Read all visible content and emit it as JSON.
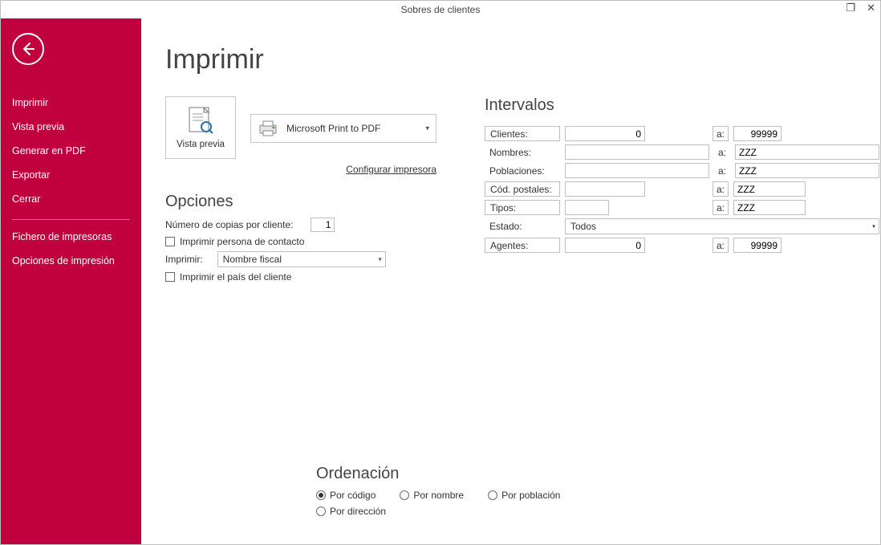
{
  "window": {
    "title": "Sobres de clientes"
  },
  "sidebar": {
    "items": [
      {
        "label": "Imprimir"
      },
      {
        "label": "Vista previa"
      },
      {
        "label": "Generar en PDF"
      },
      {
        "label": "Exportar"
      },
      {
        "label": "Cerrar"
      }
    ],
    "items2": [
      {
        "label": "Fichero de impresoras"
      },
      {
        "label": "Opciones de impresión"
      }
    ]
  },
  "page": {
    "title": "Imprimir"
  },
  "preview": {
    "label": "Vista previa",
    "printer": "Microsoft Print to PDF",
    "configure": "Configurar impresora"
  },
  "opciones": {
    "heading": "Opciones",
    "copies_label": "Número de copias por cliente:",
    "copies_value": "1",
    "print_contact": "Imprimir persona de contacto",
    "print_label": "Imprimir:",
    "print_select": "Nombre fiscal",
    "print_country": "Imprimir el país del cliente"
  },
  "intervalos": {
    "heading": "Intervalos",
    "a": "a:",
    "rows": {
      "clientes": {
        "label": "Clientes:",
        "from": "0",
        "to": "99999"
      },
      "nombres": {
        "label": "Nombres:",
        "from": "",
        "to": "ZZZ"
      },
      "poblaciones": {
        "label": "Poblaciones:",
        "from": "",
        "to": "ZZZ"
      },
      "codpost": {
        "label": "Cód. postales:",
        "from": "",
        "to": "ZZZ"
      },
      "tipos": {
        "label": "Tipos:",
        "from": "",
        "to": "ZZZ"
      },
      "estado": {
        "label": "Estado:",
        "value": "Todos"
      },
      "agentes": {
        "label": "Agentes:",
        "from": "0",
        "to": "99999"
      }
    }
  },
  "ordenacion": {
    "heading": "Ordenación",
    "options": {
      "codigo": "Por código",
      "nombre": "Por nombre",
      "poblacion": "Por población",
      "direccion": "Por dirección"
    }
  }
}
